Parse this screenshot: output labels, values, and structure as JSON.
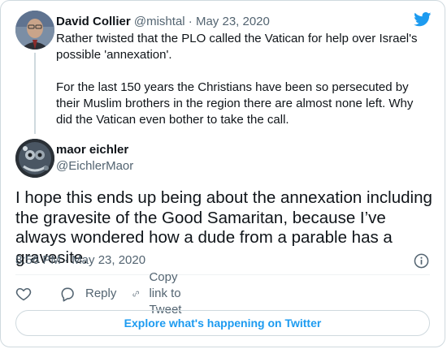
{
  "parent_tweet": {
    "name": "David Collier",
    "handle": "@mishtal",
    "separator": "·",
    "date": "May 23, 2020",
    "paragraphs": [
      "Rather twisted that the PLO called the Vatican for help over Israel's possible 'annexation'.",
      "For the last 150 years the Christians have been so persecuted by their Muslim brothers in the region there are almost none left. Why did the Vatican even bother to take the call."
    ]
  },
  "main_tweet": {
    "name": "maor eichler",
    "handle": "@EichlerMaor",
    "text": "I hope this ends up being about the annexation including the gravesite of the Good Samaritan, because I’ve always wondered how a dude from a parable has a gravesite.",
    "timestamp": "8:56 PM · May 23, 2020"
  },
  "actions": {
    "like_icon": "heart-icon",
    "reply_label": "Reply",
    "copy_label": "Copy link to Tweet"
  },
  "explore_label": "Explore what's happening on Twitter",
  "colors": {
    "brand": "#1d9bf0",
    "text": "#0f1419",
    "muted": "#536471",
    "border": "#cfd9de"
  }
}
